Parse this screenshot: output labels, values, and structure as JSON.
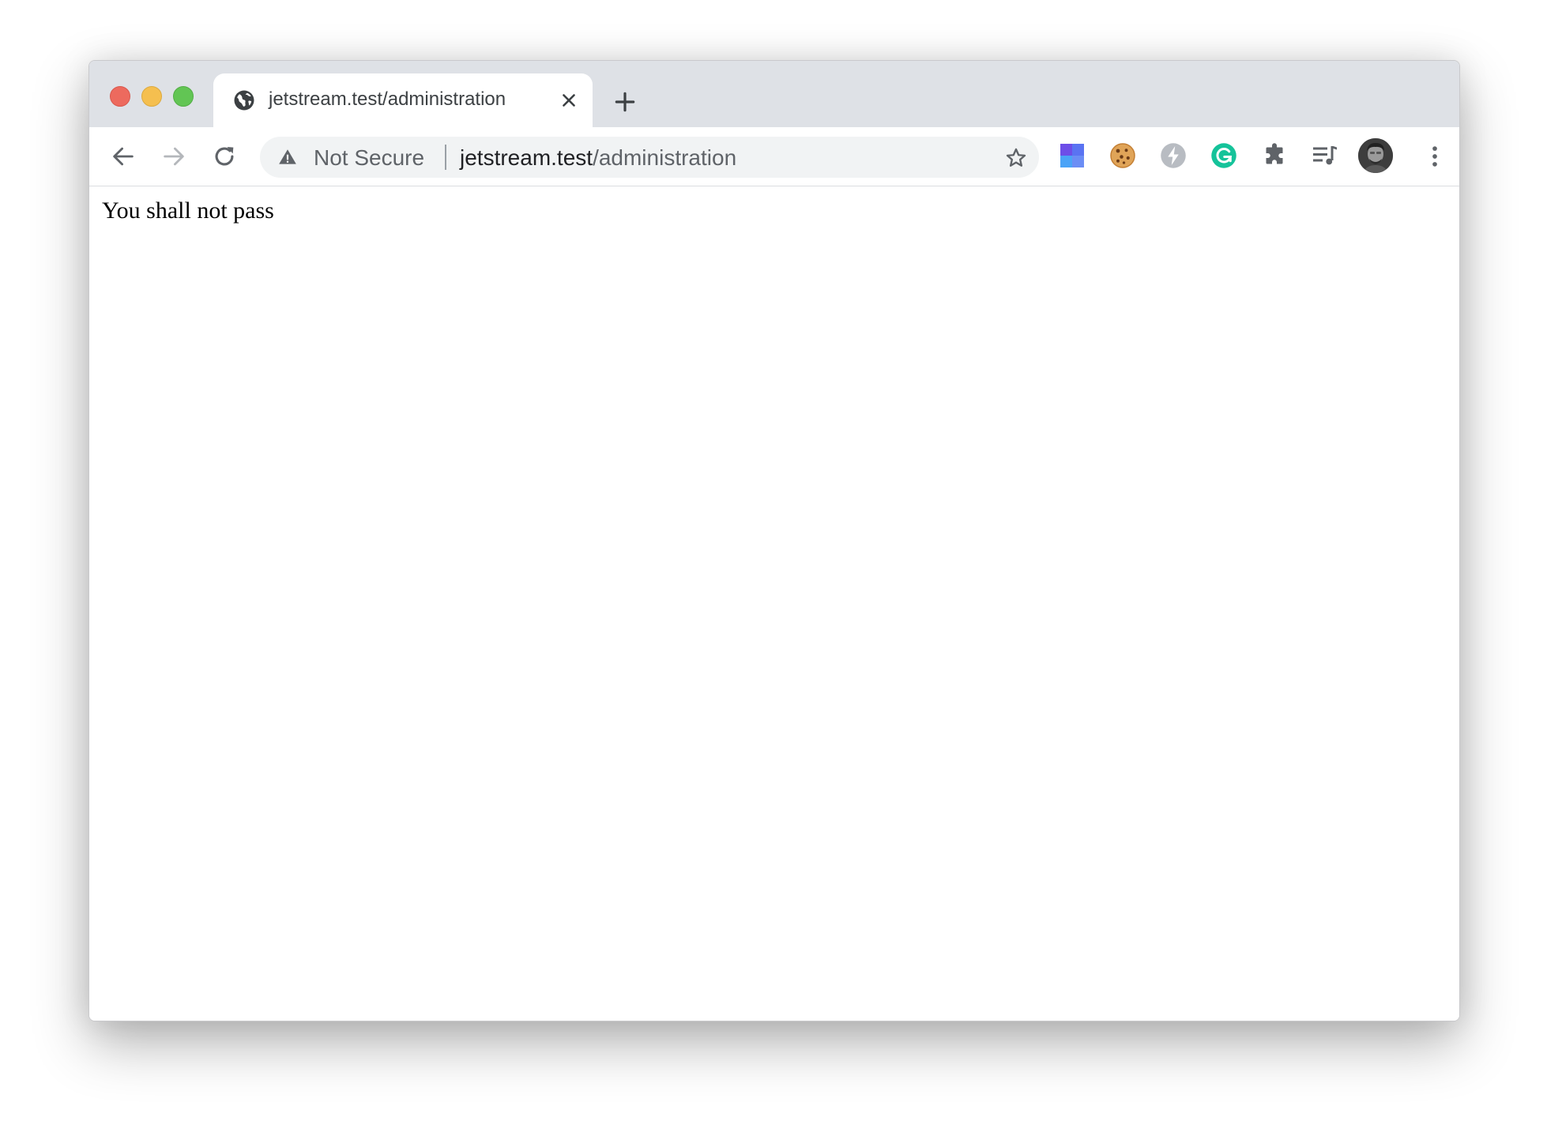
{
  "window": {
    "traffic_lights": [
      "close",
      "minimize",
      "maximize"
    ]
  },
  "tab": {
    "title": "jetstream.test/administration",
    "favicon_icon": "globe-icon",
    "close_icon": "close-icon"
  },
  "new_tab": {
    "icon": "plus-icon"
  },
  "toolbar": {
    "back_icon": "arrow-left-icon",
    "forward_icon": "arrow-right-icon",
    "reload_icon": "reload-icon"
  },
  "omnibox": {
    "security_icon": "warning-triangle-icon",
    "security_label": "Not Secure",
    "url_host": "jetstream.test",
    "url_path": "/administration",
    "bookmark_icon": "star-outline-icon"
  },
  "extensions": [
    {
      "name": "grid-extension-icon",
      "color": "#5b6cf0"
    },
    {
      "name": "cookie-extension-icon",
      "color": "#d99a4e"
    },
    {
      "name": "bolt-extension-icon",
      "color": "#b8bcc2"
    },
    {
      "name": "grammarly-extension-icon",
      "color": "#15c39a"
    },
    {
      "name": "puzzle-extensions-icon",
      "color": "#5f6368"
    },
    {
      "name": "media-queue-icon",
      "color": "#5f6368"
    }
  ],
  "profile": {
    "icon": "avatar"
  },
  "menu": {
    "icon": "kebab-menu-icon"
  },
  "page": {
    "message": "You shall not pass"
  },
  "colors": {
    "titlebar": "#dee1e6",
    "omnibox": "#f1f3f4",
    "icon_gray": "#5f6368"
  }
}
